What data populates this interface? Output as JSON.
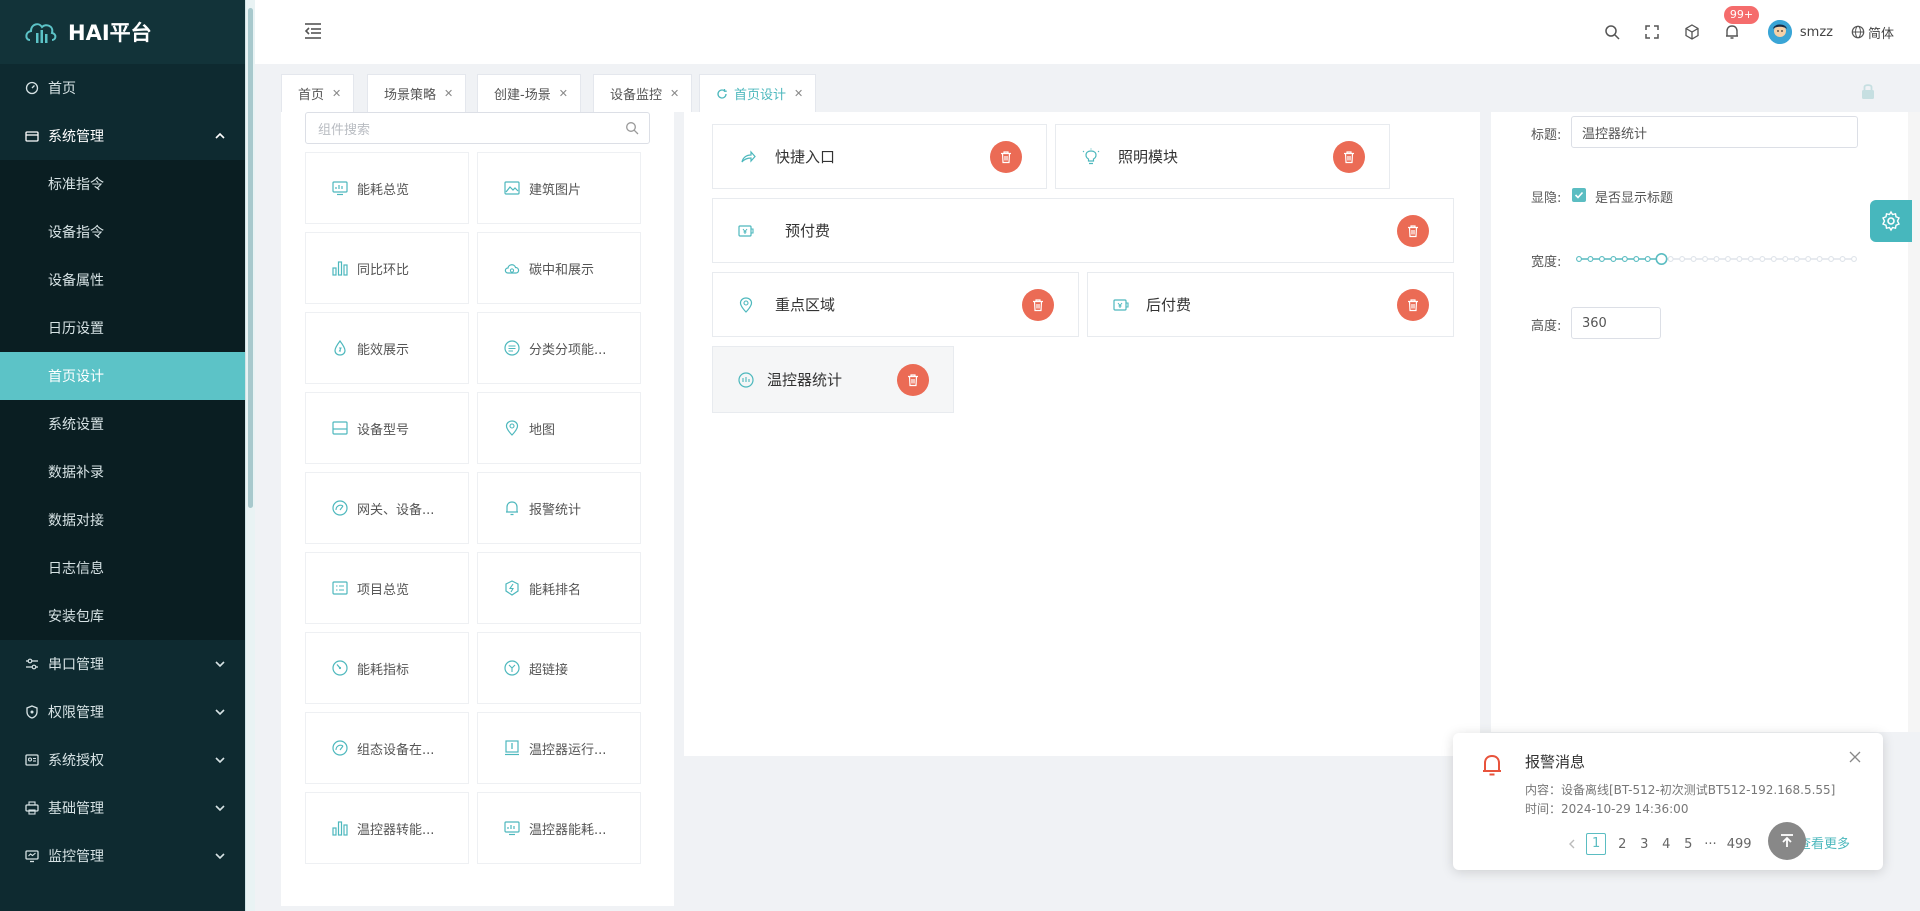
{
  "app": {
    "title": "HAI平台"
  },
  "sidebar": {
    "items": [
      {
        "label": "首页",
        "icon": "dashboard-icon"
      },
      {
        "label": "系统管理",
        "icon": "card-icon",
        "open": true
      },
      {
        "label": "串口管理",
        "icon": "sliders-icon"
      },
      {
        "label": "权限管理",
        "icon": "shield-icon"
      },
      {
        "label": "系统授权",
        "icon": "badge-icon"
      },
      {
        "label": "基础管理",
        "icon": "printer-icon"
      },
      {
        "label": "监控管理",
        "icon": "monitor-icon"
      }
    ],
    "sub_items": [
      "标准指令",
      "设备指令",
      "设备属性",
      "日历设置",
      "首页设计",
      "系统设置",
      "数据补录",
      "数据对接",
      "日志信息",
      "安装包库"
    ],
    "active_sub": "首页设计"
  },
  "header": {
    "badge": "99+",
    "username": "smzz",
    "language": "简体"
  },
  "tabs": [
    {
      "label": "首页"
    },
    {
      "label": "场景策略"
    },
    {
      "label": "创建-场景"
    },
    {
      "label": "设备监控"
    },
    {
      "label": "首页设计",
      "active": true
    }
  ],
  "components": {
    "search_placeholder": "组件搜索",
    "items": [
      {
        "label": "能耗总览",
        "icon": "monitor-chart-icon"
      },
      {
        "label": "建筑图片",
        "icon": "image-icon"
      },
      {
        "label": "同比环比",
        "icon": "bar-chart-icon"
      },
      {
        "label": "碳中和展示",
        "icon": "cloud-icon"
      },
      {
        "label": "能效展示",
        "icon": "drop-icon"
      },
      {
        "label": "分类分项能...",
        "icon": "list-circle-icon"
      },
      {
        "label": "设备型号",
        "icon": "card-icon"
      },
      {
        "label": "地图",
        "icon": "map-pin-icon"
      },
      {
        "label": "网关、设备...",
        "icon": "gauge-icon"
      },
      {
        "label": "报警统计",
        "icon": "bell-icon"
      },
      {
        "label": "项目总览",
        "icon": "table-icon"
      },
      {
        "label": "能耗排名",
        "icon": "lightning-icon"
      },
      {
        "label": "能耗指标",
        "icon": "speedometer-icon"
      },
      {
        "label": "超链接",
        "icon": "link-icon"
      },
      {
        "label": "组态设备在...",
        "icon": "gauge-icon"
      },
      {
        "label": "温控器运行...",
        "icon": "thermometer-icon"
      },
      {
        "label": "温控器转能...",
        "icon": "bar-chart-icon"
      },
      {
        "label": "温控器能耗...",
        "icon": "monitor-chart-icon"
      }
    ]
  },
  "canvas": {
    "blocks": [
      {
        "label": "快捷入口",
        "icon": "share-icon"
      },
      {
        "label": "照明模块",
        "icon": "bulb-icon"
      },
      {
        "label": "预付费",
        "icon": "payment-icon"
      },
      {
        "label": "重点区域",
        "icon": "map-pin-icon"
      },
      {
        "label": "后付费",
        "icon": "payment-icon"
      },
      {
        "label": "温控器统计",
        "icon": "thermometer-circle-icon",
        "selected": true
      }
    ]
  },
  "properties": {
    "title_label": "标题:",
    "title_value": "温控器统计",
    "visible_label": "显隐:",
    "visible_option": "是否显示标题",
    "visible_checked": true,
    "width_label": "宽度:",
    "width_level": 0.3,
    "height_label": "高度:",
    "height_value": "360"
  },
  "notification": {
    "title": "报警消息",
    "content": "内容：设备离线[BT-512-初次测试BT512-192.168.5.55]",
    "time": "时间：2024-10-29 14:36:00",
    "pages": [
      "1",
      "2",
      "3",
      "4",
      "5",
      "···",
      "499"
    ],
    "current_page": "1",
    "more": "查看更多"
  },
  "colors": {
    "accent": "#5cc3c7",
    "sidebar_bg": "#0e2a30",
    "delete": "#eb6b55",
    "badge": "#f56c6c"
  }
}
